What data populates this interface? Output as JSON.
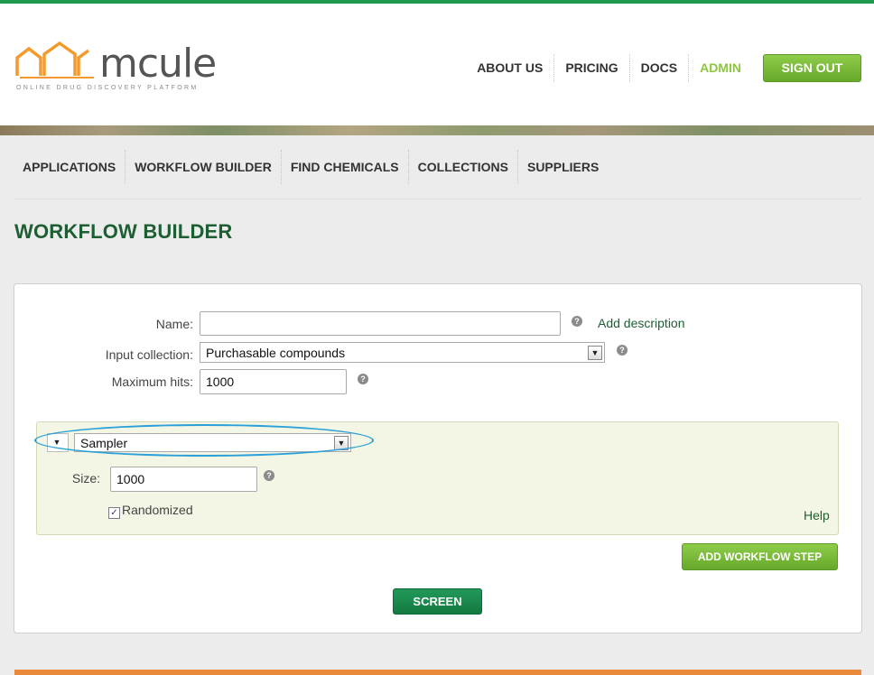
{
  "brand": {
    "name": "mcule",
    "tagline": "ONLINE DRUG DISCOVERY PLATFORM",
    "logo_color": "#f39a2c"
  },
  "top_nav": {
    "items": [
      "ABOUT US",
      "PRICING",
      "DOCS",
      "ADMIN"
    ],
    "signout_label": "SIGN OUT"
  },
  "main_nav": {
    "items": [
      "APPLICATIONS",
      "WORKFLOW BUILDER",
      "FIND CHEMICALS",
      "COLLECTIONS",
      "SUPPLIERS"
    ]
  },
  "page": {
    "title": "WORKFLOW BUILDER"
  },
  "form": {
    "name_label": "Name:",
    "name_value": "",
    "add_description": "Add description",
    "input_collection_label": "Input collection:",
    "input_collection_value": "Purchasable compounds",
    "max_hits_label": "Maximum hits:",
    "max_hits_value": "1000",
    "help_glyph": "?"
  },
  "step": {
    "type_value": "Sampler",
    "size_label": "Size:",
    "size_value": "1000",
    "randomized_label": "Randomized",
    "randomized_checked": true,
    "help_label": "Help"
  },
  "actions": {
    "add_step_label": "ADD WORKFLOW STEP",
    "screen_label": "SCREEN"
  },
  "colors": {
    "accent_green": "#8dc63f",
    "dark_green": "#1e5e33",
    "highlight_oval": "#2a9fd8",
    "bottom_bar": "#e9893a"
  }
}
